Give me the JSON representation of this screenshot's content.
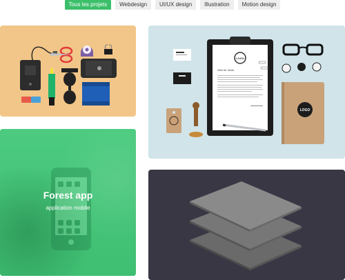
{
  "filters": [
    {
      "label": "Tous les projets",
      "active": true
    },
    {
      "label": "Webdesign",
      "active": false
    },
    {
      "label": "UI/UX design",
      "active": false
    },
    {
      "label": "Illustration",
      "active": false
    },
    {
      "label": "Motion design",
      "active": false
    }
  ],
  "colors": {
    "accent": "#3cbf6a",
    "tile_desk_bg": "#f2c688",
    "tile_stationery_bg": "#d0e4ea",
    "tile_forest_bg": "#46c57a",
    "tile_layers_bg": "#3a3745"
  },
  "projects": {
    "forest": {
      "title": "Forest app",
      "subtitle": "application mobile"
    },
    "stationery": {
      "letter_greeting": "Hello Mr. Smith,",
      "logo_text": "LOGO"
    }
  },
  "icons": {
    "desk": [
      "external-hard-drive-icon",
      "scissors-icon",
      "tape-dispenser-icon",
      "binder-clip-icon",
      "highlighter-icon",
      "sunglasses-icon",
      "smartphone-icon",
      "eraser-icon",
      "notebook-icon",
      "cable-icon"
    ],
    "stationery": [
      "clipboard-icon",
      "letter-icon",
      "business-card-icon",
      "price-tag-icon",
      "wax-seal-stamp-icon",
      "pen-icon",
      "glasses-icon",
      "badge-icon",
      "notebook-icon",
      "paper-clip-icon"
    ],
    "layers": [
      "stacked-layers-icon"
    ]
  }
}
